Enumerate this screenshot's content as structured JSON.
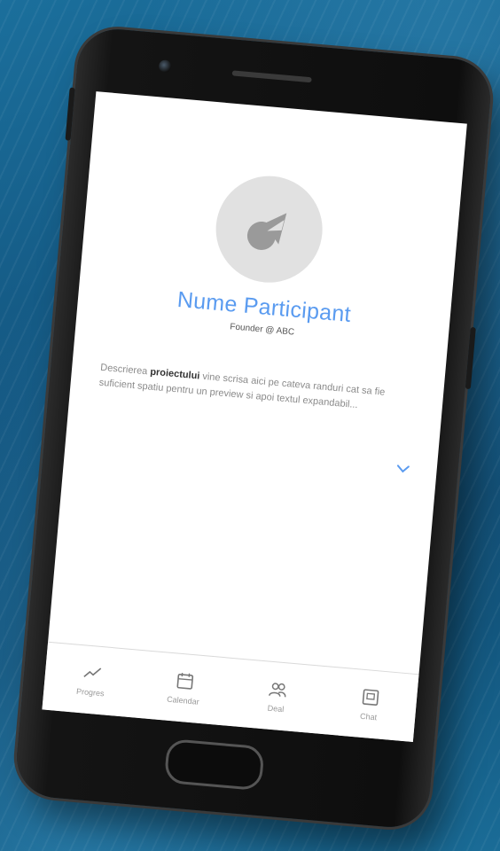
{
  "profile": {
    "name": "Nume Participant",
    "role": "Founder @ ABC",
    "description_before": "Descrierea ",
    "description_bold": "proiectului",
    "description_after": " vine scrisa aici pe cateva randuri cat sa fie suficient spatiu pentru un preview si apoi textul expandabil..."
  },
  "tabs": [
    {
      "label": "Progres",
      "icon": "trend-icon"
    },
    {
      "label": "Calendar",
      "icon": "calendar-icon"
    },
    {
      "label": "Deal",
      "icon": "people-icon"
    },
    {
      "label": "Chat",
      "icon": "chat-icon"
    }
  ],
  "colors": {
    "accent": "#5a9bf0",
    "background": "#13557f",
    "screen": "#ffffff",
    "avatar": "#e1e1e1"
  }
}
